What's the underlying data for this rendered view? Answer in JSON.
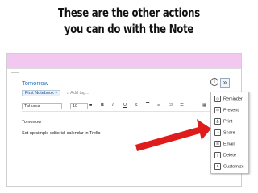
{
  "slide": {
    "title_line1": "These are the other actions",
    "title_line2": "you can do with the Note"
  },
  "note": {
    "title": "Tomorrow",
    "notebook": "First Notebook ▾",
    "add_tag": "Add tag...",
    "body_line1": "Tomorrow",
    "body_line2": "Set up simple editorial calendar in Trello"
  },
  "toolbar": {
    "font": "Tahoma",
    "size": "10",
    "bold": "B",
    "italic": "I",
    "underline": "U",
    "strike": "S"
  },
  "menu": {
    "items": [
      "Reminder",
      "Present",
      "Print",
      "Share",
      "Email",
      "Delete",
      "Customize"
    ]
  },
  "colors": {
    "arrow": "#e01b1b",
    "window_bar": "#f3c8f0",
    "title_blue": "#2a70b8"
  }
}
